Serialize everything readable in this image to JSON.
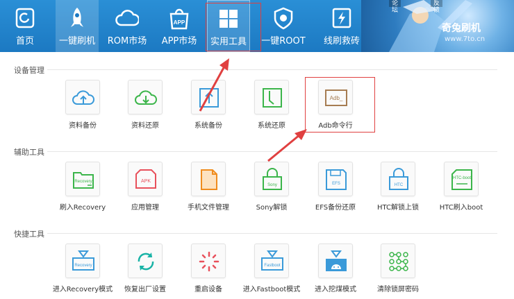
{
  "topnav": {
    "items": [
      {
        "label": "首页",
        "icon": "home-icon"
      },
      {
        "label": "一键刷机",
        "icon": "rocket-icon"
      },
      {
        "label": "ROM市场",
        "icon": "cloud-icon"
      },
      {
        "label": "APP市场",
        "icon": "app-bag-icon"
      },
      {
        "label": "实用工具",
        "icon": "grid-icon"
      },
      {
        "label": "一键ROOT",
        "icon": "root-icon"
      },
      {
        "label": "线刷救砖",
        "icon": "flash-icon"
      }
    ],
    "brand": "奇兔刷机",
    "brand_url": "www.7to.cn",
    "window_tabs": [
      "论坛",
      "反馈"
    ]
  },
  "sections": [
    {
      "title": "设备管理",
      "tools": [
        {
          "label": "资料备份",
          "icon": "cloud-upload-icon"
        },
        {
          "label": "资料还原",
          "icon": "cloud-download-icon"
        },
        {
          "label": "系统备份",
          "icon": "system-backup-icon"
        },
        {
          "label": "系统还原",
          "icon": "system-restore-icon"
        },
        {
          "label": "Adb命令行",
          "icon": "adb-terminal-icon",
          "badge": "Adb_"
        }
      ]
    },
    {
      "title": "辅助工具",
      "tools": [
        {
          "label": "刷入Recovery",
          "icon": "recovery-folder-icon",
          "badge": "Recovery"
        },
        {
          "label": "应用管理",
          "icon": "apk-icon",
          "badge": "APK"
        },
        {
          "label": "手机文件管理",
          "icon": "file-icon"
        },
        {
          "label": "Sony解锁",
          "icon": "sony-lock-icon",
          "badge": "Sony"
        },
        {
          "label": "EFS备份还原",
          "icon": "efs-icon",
          "badge": "EFS"
        },
        {
          "label": "HTC解锁上锁",
          "icon": "htc-lock-icon",
          "badge": "HTC"
        },
        {
          "label": "HTC刷入boot",
          "icon": "htc-boot-icon",
          "badge": "HTC-boot"
        }
      ]
    },
    {
      "title": "快捷工具",
      "tools": [
        {
          "label": "进入Recovery模式",
          "icon": "enter-recovery-icon",
          "badge": "Recovery"
        },
        {
          "label": "恢复出厂设置",
          "icon": "factory-reset-icon"
        },
        {
          "label": "重启设备",
          "icon": "reboot-icon"
        },
        {
          "label": "进入Fastboot模式",
          "icon": "fastboot-icon",
          "badge": "Fastboot"
        },
        {
          "label": "进入挖煤模式",
          "icon": "android-download-icon"
        },
        {
          "label": "清除锁屏密码",
          "icon": "pattern-lock-icon"
        }
      ]
    }
  ],
  "colors": {
    "topbar": "#1c79c2",
    "blue": "#3a9ad9",
    "green": "#3bb54a",
    "red": "#e8505b",
    "orange": "#f08c1e",
    "brown": "#a67c52",
    "highlight": "#e04040"
  }
}
